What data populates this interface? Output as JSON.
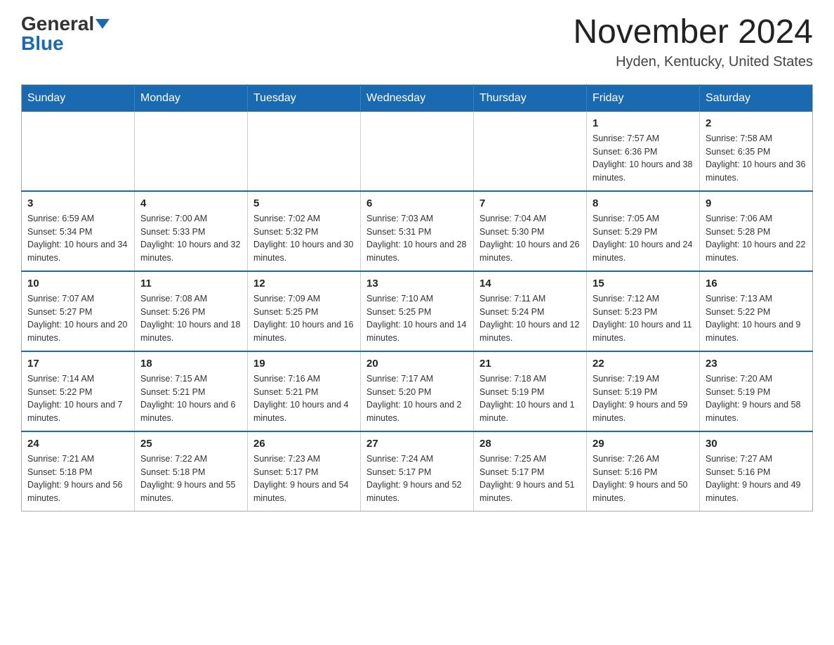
{
  "logo": {
    "general": "General",
    "blue": "Blue"
  },
  "title": "November 2024",
  "location": "Hyden, Kentucky, United States",
  "days_of_week": [
    "Sunday",
    "Monday",
    "Tuesday",
    "Wednesday",
    "Thursday",
    "Friday",
    "Saturday"
  ],
  "weeks": [
    [
      {
        "day": "",
        "info": ""
      },
      {
        "day": "",
        "info": ""
      },
      {
        "day": "",
        "info": ""
      },
      {
        "day": "",
        "info": ""
      },
      {
        "day": "",
        "info": ""
      },
      {
        "day": "1",
        "info": "Sunrise: 7:57 AM\nSunset: 6:36 PM\nDaylight: 10 hours and 38 minutes."
      },
      {
        "day": "2",
        "info": "Sunrise: 7:58 AM\nSunset: 6:35 PM\nDaylight: 10 hours and 36 minutes."
      }
    ],
    [
      {
        "day": "3",
        "info": "Sunrise: 6:59 AM\nSunset: 5:34 PM\nDaylight: 10 hours and 34 minutes."
      },
      {
        "day": "4",
        "info": "Sunrise: 7:00 AM\nSunset: 5:33 PM\nDaylight: 10 hours and 32 minutes."
      },
      {
        "day": "5",
        "info": "Sunrise: 7:02 AM\nSunset: 5:32 PM\nDaylight: 10 hours and 30 minutes."
      },
      {
        "day": "6",
        "info": "Sunrise: 7:03 AM\nSunset: 5:31 PM\nDaylight: 10 hours and 28 minutes."
      },
      {
        "day": "7",
        "info": "Sunrise: 7:04 AM\nSunset: 5:30 PM\nDaylight: 10 hours and 26 minutes."
      },
      {
        "day": "8",
        "info": "Sunrise: 7:05 AM\nSunset: 5:29 PM\nDaylight: 10 hours and 24 minutes."
      },
      {
        "day": "9",
        "info": "Sunrise: 7:06 AM\nSunset: 5:28 PM\nDaylight: 10 hours and 22 minutes."
      }
    ],
    [
      {
        "day": "10",
        "info": "Sunrise: 7:07 AM\nSunset: 5:27 PM\nDaylight: 10 hours and 20 minutes."
      },
      {
        "day": "11",
        "info": "Sunrise: 7:08 AM\nSunset: 5:26 PM\nDaylight: 10 hours and 18 minutes."
      },
      {
        "day": "12",
        "info": "Sunrise: 7:09 AM\nSunset: 5:25 PM\nDaylight: 10 hours and 16 minutes."
      },
      {
        "day": "13",
        "info": "Sunrise: 7:10 AM\nSunset: 5:25 PM\nDaylight: 10 hours and 14 minutes."
      },
      {
        "day": "14",
        "info": "Sunrise: 7:11 AM\nSunset: 5:24 PM\nDaylight: 10 hours and 12 minutes."
      },
      {
        "day": "15",
        "info": "Sunrise: 7:12 AM\nSunset: 5:23 PM\nDaylight: 10 hours and 11 minutes."
      },
      {
        "day": "16",
        "info": "Sunrise: 7:13 AM\nSunset: 5:22 PM\nDaylight: 10 hours and 9 minutes."
      }
    ],
    [
      {
        "day": "17",
        "info": "Sunrise: 7:14 AM\nSunset: 5:22 PM\nDaylight: 10 hours and 7 minutes."
      },
      {
        "day": "18",
        "info": "Sunrise: 7:15 AM\nSunset: 5:21 PM\nDaylight: 10 hours and 6 minutes."
      },
      {
        "day": "19",
        "info": "Sunrise: 7:16 AM\nSunset: 5:21 PM\nDaylight: 10 hours and 4 minutes."
      },
      {
        "day": "20",
        "info": "Sunrise: 7:17 AM\nSunset: 5:20 PM\nDaylight: 10 hours and 2 minutes."
      },
      {
        "day": "21",
        "info": "Sunrise: 7:18 AM\nSunset: 5:19 PM\nDaylight: 10 hours and 1 minute."
      },
      {
        "day": "22",
        "info": "Sunrise: 7:19 AM\nSunset: 5:19 PM\nDaylight: 9 hours and 59 minutes."
      },
      {
        "day": "23",
        "info": "Sunrise: 7:20 AM\nSunset: 5:19 PM\nDaylight: 9 hours and 58 minutes."
      }
    ],
    [
      {
        "day": "24",
        "info": "Sunrise: 7:21 AM\nSunset: 5:18 PM\nDaylight: 9 hours and 56 minutes."
      },
      {
        "day": "25",
        "info": "Sunrise: 7:22 AM\nSunset: 5:18 PM\nDaylight: 9 hours and 55 minutes."
      },
      {
        "day": "26",
        "info": "Sunrise: 7:23 AM\nSunset: 5:17 PM\nDaylight: 9 hours and 54 minutes."
      },
      {
        "day": "27",
        "info": "Sunrise: 7:24 AM\nSunset: 5:17 PM\nDaylight: 9 hours and 52 minutes."
      },
      {
        "day": "28",
        "info": "Sunrise: 7:25 AM\nSunset: 5:17 PM\nDaylight: 9 hours and 51 minutes."
      },
      {
        "day": "29",
        "info": "Sunrise: 7:26 AM\nSunset: 5:16 PM\nDaylight: 9 hours and 50 minutes."
      },
      {
        "day": "30",
        "info": "Sunrise: 7:27 AM\nSunset: 5:16 PM\nDaylight: 9 hours and 49 minutes."
      }
    ]
  ]
}
